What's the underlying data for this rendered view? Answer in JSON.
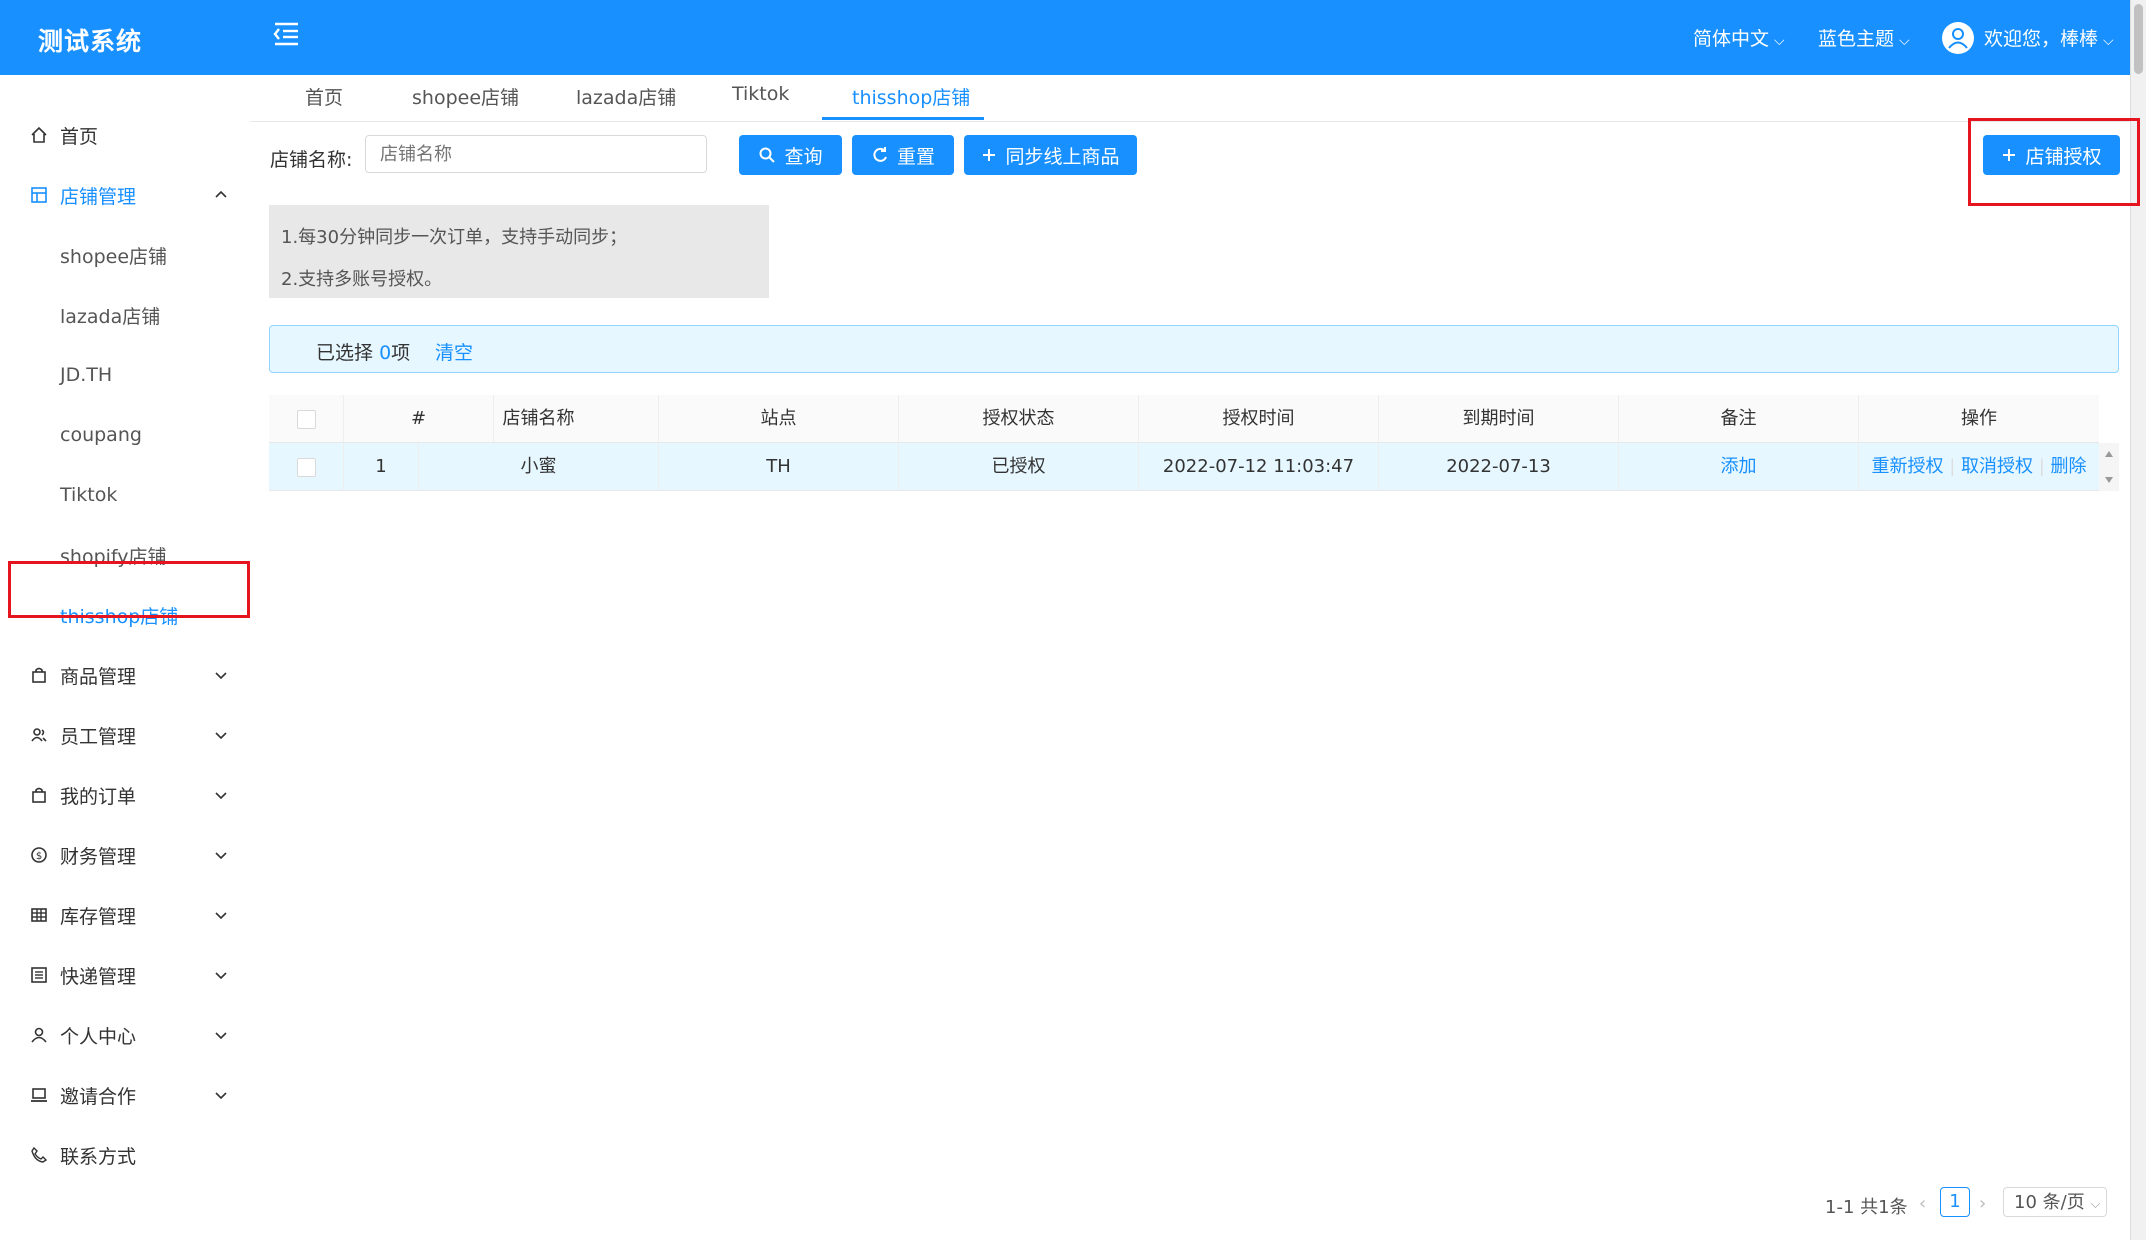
{
  "header": {
    "logo": "测试系统",
    "language": "简体中文",
    "theme": "蓝色主题",
    "welcome": "欢迎您，棒棒"
  },
  "sidebar": {
    "items": [
      {
        "label": "首页",
        "icon": "home-icon"
      },
      {
        "label": "店铺管理",
        "icon": "store-icon"
      },
      {
        "label": "shopee店铺"
      },
      {
        "label": "lazada店铺"
      },
      {
        "label": "JD.TH"
      },
      {
        "label": "coupang"
      },
      {
        "label": "Tiktok"
      },
      {
        "label": "shopify店铺"
      },
      {
        "label": "thisshop店铺"
      },
      {
        "label": "商品管理",
        "icon": "bag-icon"
      },
      {
        "label": "员工管理",
        "icon": "staff-icon"
      },
      {
        "label": "我的订单",
        "icon": "order-icon"
      },
      {
        "label": "财务管理",
        "icon": "money-icon"
      },
      {
        "label": "库存管理",
        "icon": "grid-icon"
      },
      {
        "label": "快递管理",
        "icon": "list-icon"
      },
      {
        "label": "个人中心",
        "icon": "user-icon"
      },
      {
        "label": "邀请合作",
        "icon": "laptop-icon"
      },
      {
        "label": "联系方式",
        "icon": "phone-icon"
      }
    ]
  },
  "tabs": [
    "首页",
    "shopee店铺",
    "lazada店铺",
    "Tiktok",
    "thisshop店铺"
  ],
  "search": {
    "label": "店铺名称:",
    "placeholder": "店铺名称",
    "query_btn": "查询",
    "reset_btn": "重置",
    "sync_btn": "同步线上商品",
    "auth_btn": "店铺授权"
  },
  "notice": {
    "line1": "1.每30分钟同步一次订单，支持手动同步；",
    "line2": "2.支持多账号授权。"
  },
  "selection": {
    "prefix": "已选择",
    "count": "0",
    "suffix": "项",
    "clear": "清空"
  },
  "table": {
    "headers": [
      "#",
      "店铺名称",
      "站点",
      "授权状态",
      "授权时间",
      "到期时间",
      "备注",
      "操作"
    ],
    "rows": [
      {
        "index": "1",
        "name": "小蜜",
        "site": "TH",
        "status": "已授权",
        "auth_time": "2022-07-12 11:03:47",
        "expire": "2022-07-13",
        "remark": "添加",
        "actions": [
          "重新授权",
          "取消授权",
          "删除"
        ]
      }
    ]
  },
  "pagination": {
    "summary": "1-1 共1条",
    "page": "1",
    "page_size": "10 条/页"
  },
  "colors": {
    "primary": "#1890ff",
    "highlight": "#e6141e"
  }
}
